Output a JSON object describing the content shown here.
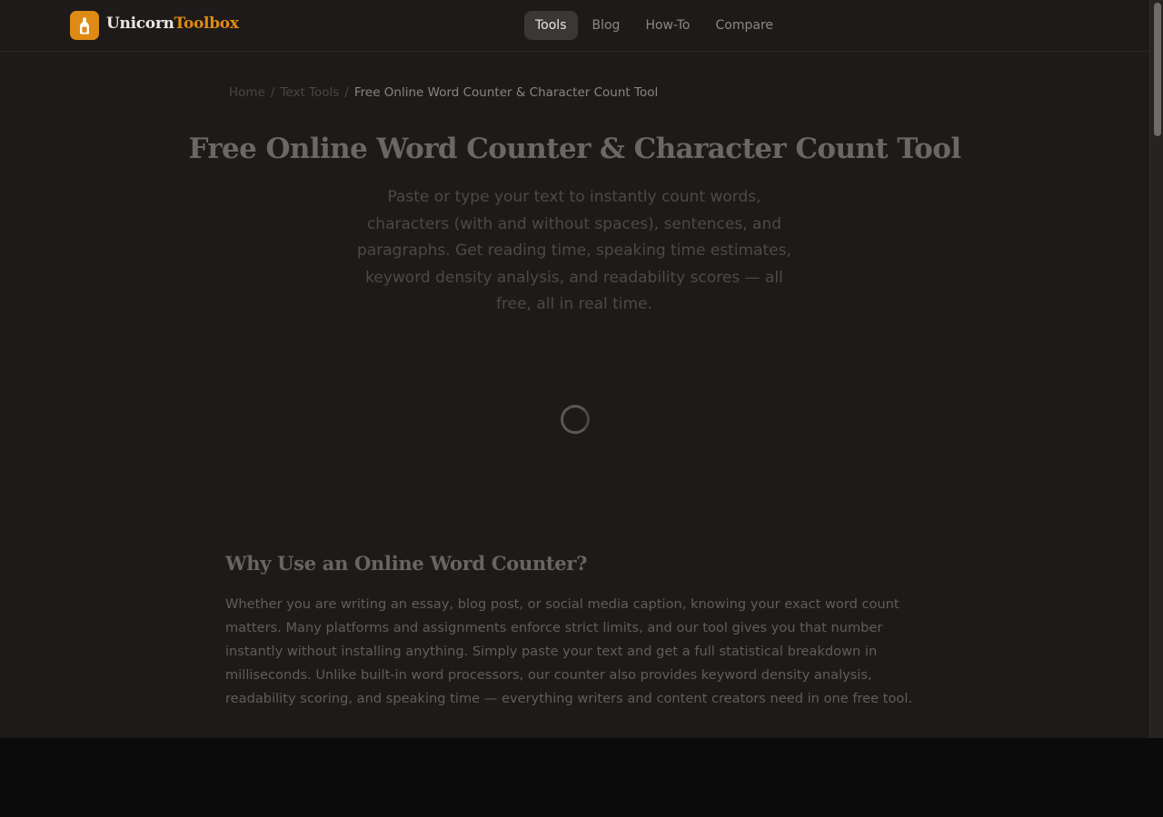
{
  "header": {
    "brand_part1": "Unicorn",
    "brand_part2": "Toolbox",
    "nav": [
      {
        "label": "Tools",
        "active": true
      },
      {
        "label": "Blog",
        "active": false
      },
      {
        "label": "How-To",
        "active": false
      },
      {
        "label": "Compare",
        "active": false
      }
    ]
  },
  "breadcrumb": {
    "home": "Home",
    "sep1": "/",
    "category": "Text Tools",
    "sep2": "/",
    "current": "Free Online Word Counter & Character Count Tool"
  },
  "hero": {
    "title": "Free Online Word Counter & Character Count Tool",
    "subtitle": "Paste or type your text to instantly count words, characters (with and without spaces), sentences, and paragraphs. Get reading time, speaking time estimates, keyword density analysis, and readability scores — all free, all in real time."
  },
  "section": {
    "title": "Why Use an Online Word Counter?",
    "body": "Whether you are writing an essay, blog post, or social media caption, knowing your exact word count matters. Many platforms and assignments enforce strict limits, and our tool gives you that number instantly without installing anything. Simply paste your text and get a full statistical breakdown in milliseconds. Unlike built-in word processors, our counter also provides keyword density analysis, readability scoring, and speaking time — everything writers and content creators need in one free tool."
  },
  "colors": {
    "accent": "#e08a16",
    "background": "#1d1a19",
    "nav_active_bg": "#3a3736"
  },
  "icons": {
    "logo": "bottle-icon",
    "loading": "loading-spinner-icon"
  }
}
